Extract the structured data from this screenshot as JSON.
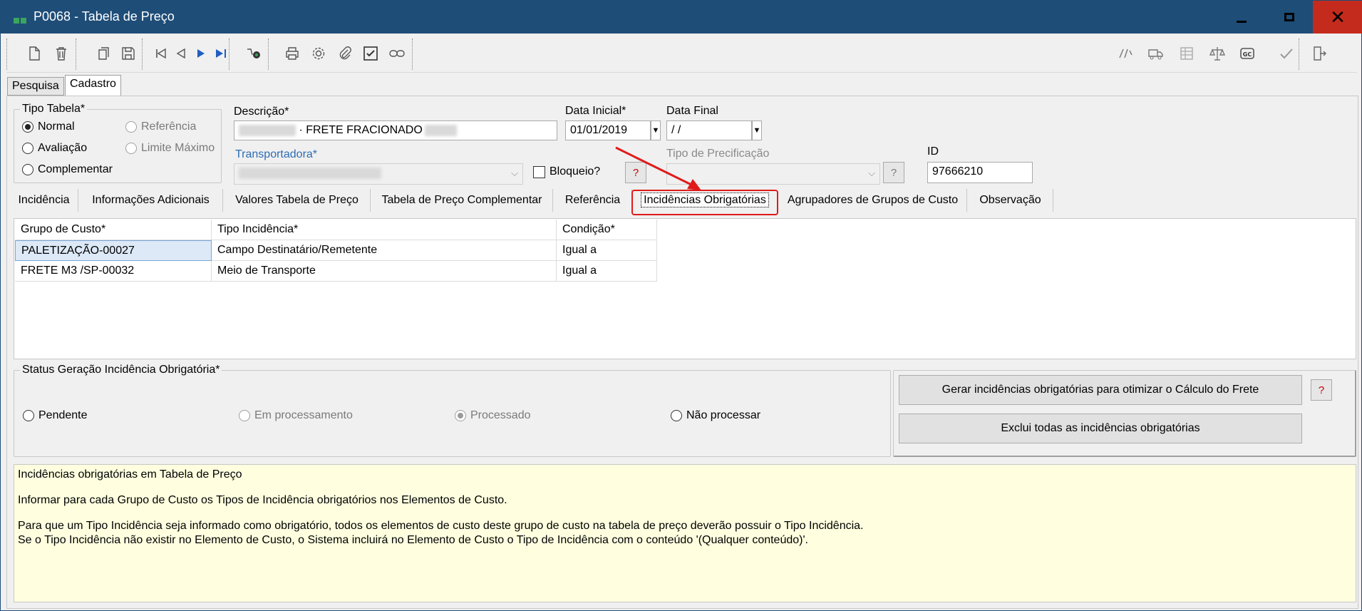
{
  "window": {
    "title": "P0068 - Tabela de Preço",
    "min_glyph": "",
    "close_glyph": "✕"
  },
  "top_tabs": [
    {
      "label": "Pesquisa"
    },
    {
      "label": "Cadastro"
    }
  ],
  "tipo_tabela": {
    "legend": "Tipo Tabela*",
    "options": [
      {
        "label": "Normal",
        "checked": true
      },
      {
        "label": "Avaliação"
      },
      {
        "label": "Complementar"
      },
      {
        "label": "Referência"
      },
      {
        "label": "Limite Máximo"
      }
    ]
  },
  "descricao": {
    "label": "Descrição*",
    "value": "· FRETE FRACIONADO"
  },
  "data_inicial": {
    "label": "Data Inicial*",
    "value": "01/01/2019"
  },
  "data_final": {
    "label": "Data Final",
    "value": " /  /"
  },
  "transportadora": {
    "label": "Transportadora*"
  },
  "bloqueio": {
    "label": "Bloqueio?"
  },
  "tipo_precificacao": {
    "label": "Tipo de Precificação"
  },
  "id_field": {
    "label": "ID",
    "value": "97666210"
  },
  "help_glyph": "?",
  "sub_tabs": [
    {
      "label": "Incidência"
    },
    {
      "label": "Informações Adicionais"
    },
    {
      "label": "Valores Tabela de Preço"
    },
    {
      "label": "Tabela de Preço Complementar"
    },
    {
      "label": "Referência"
    },
    {
      "label": "Incidências Obrigatórias"
    },
    {
      "label": "Agrupadores de Grupos de Custo"
    },
    {
      "label": "Observação"
    }
  ],
  "grid": {
    "headers": [
      "Grupo de Custo*",
      "Tipo Incidência*",
      "Condição*"
    ],
    "rows": [
      [
        "PALETIZAÇÃO-00027",
        "Campo Destinatário/Remetente",
        "Igual a"
      ],
      [
        "FRETE M3 /SP-00032",
        "Meio de Transporte",
        "Igual a"
      ]
    ]
  },
  "status_geracao": {
    "legend": "Status Geração Incidência Obrigatória*",
    "options": [
      {
        "label": "Pendente"
      },
      {
        "label": "Em processamento"
      },
      {
        "label": "Processado",
        "checked": true
      },
      {
        "label": "Não processar"
      }
    ]
  },
  "buttons": {
    "gerar": "Gerar incidências obrigatórias para otimizar o Cálculo do Frete",
    "excluir": "Exclui todas as incidências obrigatórias"
  },
  "info": {
    "title": "Incidências obrigatórias em Tabela de Preço",
    "line1": "Informar para cada Grupo de Custo os Tipos de Incidência obrigatórios nos Elementos de Custo.",
    "line2": "Para que um Tipo Incidência seja informado como obrigatório, todos os elementos de custo deste grupo de custo na tabela de preço deverão possuir o Tipo Incidência.",
    "line3": "Se o Tipo Incidência não existir no Elemento de Custo, o Sistema incluirá no Elemento de Custo o Tipo de Incidência com o conteúdo '(Qualquer conteúdo)'."
  },
  "toolbar_icons": [
    "new-doc-icon",
    "trash-icon",
    "copy-icon",
    "save-icon",
    "first-icon",
    "prev-icon",
    "next-icon",
    "last-icon",
    "search-binoculars-icon",
    "print-icon",
    "gear-icon",
    "attach-icon",
    "check-square-icon",
    "link-icon",
    "regex-icon",
    "truck-icon",
    "spreadsheet-icon",
    "scale-icon",
    "gc-icon",
    "checkmark-icon",
    "exit-icon"
  ],
  "colors": {
    "titlebar": "#1e4d78",
    "close": "#c42b1c",
    "highlight": "#e01b1b",
    "info_bg": "#ffffe0",
    "accent_blue": "#2d6db5"
  }
}
